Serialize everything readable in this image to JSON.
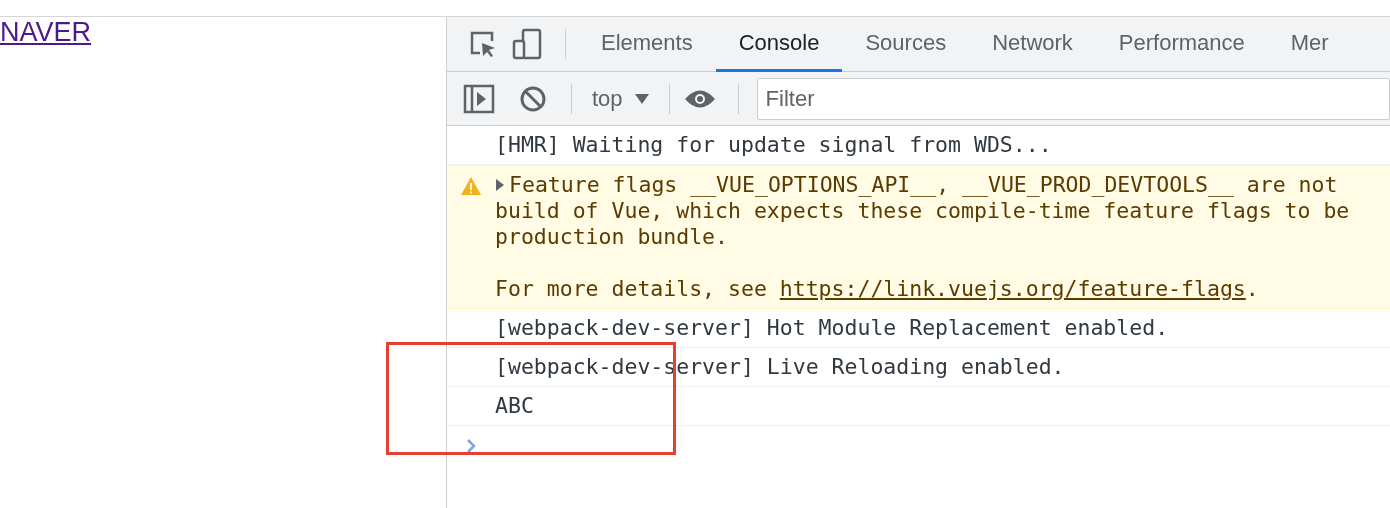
{
  "page": {
    "link": "NAVER"
  },
  "devtools": {
    "tabs": [
      {
        "label": "Elements",
        "selected": false
      },
      {
        "label": "Console",
        "selected": true
      },
      {
        "label": "Sources",
        "selected": false
      },
      {
        "label": "Network",
        "selected": false
      },
      {
        "label": "Performance",
        "selected": false
      },
      {
        "label": "Mer",
        "selected": false
      }
    ],
    "context": "top",
    "filter": {
      "placeholder": "Filter"
    }
  },
  "console": {
    "messages": [
      {
        "kind": "log",
        "text": "[HMR] Waiting for update signal from WDS..."
      },
      {
        "kind": "warning",
        "expanded": false,
        "lines": [
          "Feature flags __VUE_OPTIONS_API__, __VUE_PROD_DEVTOOLS__ are not",
          "build of Vue, which expects these compile-time feature flags to be",
          "production bundle."
        ],
        "details": "For more details, see ",
        "link": "https://link.vuejs.org/feature-flags",
        "suffix": "."
      },
      {
        "kind": "log",
        "text": "[webpack-dev-server] Hot Module Replacement enabled."
      },
      {
        "kind": "log",
        "text": "[webpack-dev-server] Live Reloading enabled."
      },
      {
        "kind": "log",
        "text": "ABC"
      }
    ]
  }
}
